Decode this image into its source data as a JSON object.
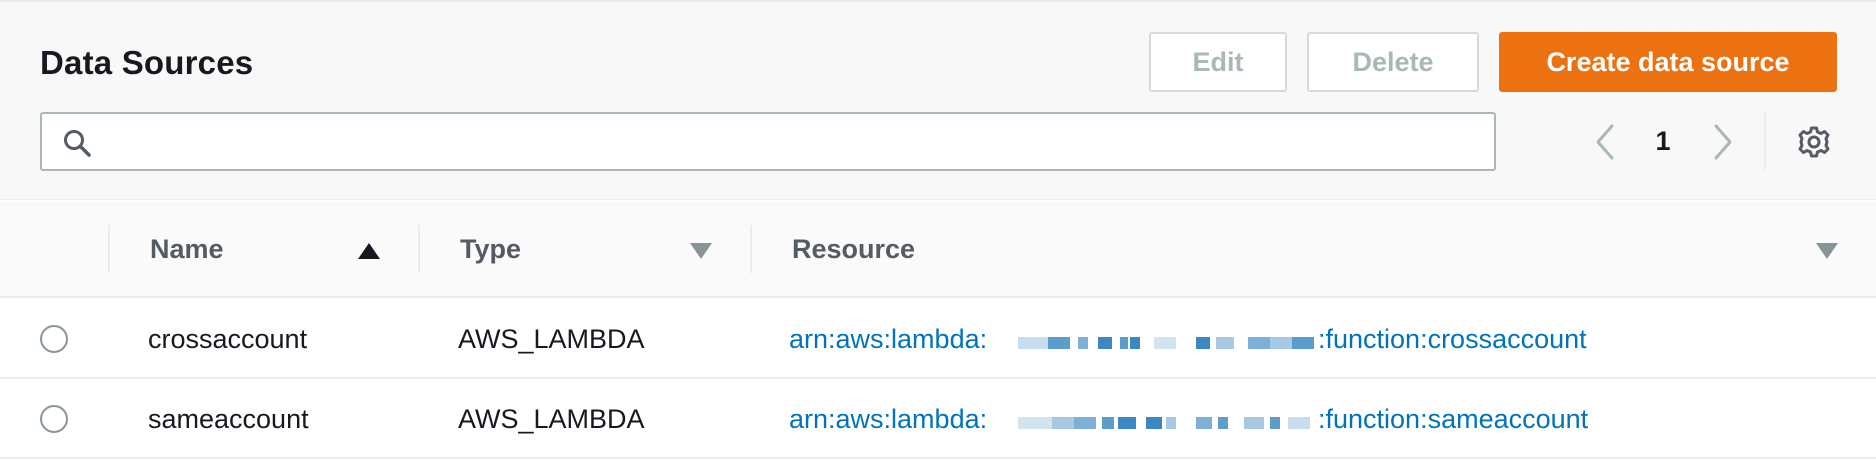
{
  "header": {
    "title": "Data Sources",
    "edit_label": "Edit",
    "delete_label": "Delete",
    "create_label": "Create data source",
    "search": {
      "value": "",
      "placeholder": ""
    },
    "page_number": "1"
  },
  "table": {
    "columns": [
      {
        "label": "Name",
        "sort": "ascending"
      },
      {
        "label": "Type",
        "sort": "none"
      },
      {
        "label": "Resource",
        "sort": "none"
      }
    ],
    "rows": [
      {
        "name": "crossaccount",
        "type": "AWS_LAMBDA",
        "resource_prefix": "arn:aws:lambda:",
        "resource_suffix": ":function:crossaccount",
        "selected": false
      },
      {
        "name": "sameaccount",
        "type": "AWS_LAMBDA",
        "resource_prefix": "arn:aws:lambda:",
        "resource_suffix": ":function:sameaccount",
        "selected": false
      }
    ]
  },
  "colors": {
    "primary": "#ec7211",
    "link": "#0073bb",
    "text": "#16191f",
    "muted": "#545b64",
    "disabled": "#aab7b8",
    "border": "#eaeded"
  },
  "icons": [
    "search-icon",
    "chevron-left-icon",
    "chevron-right-icon",
    "gear-icon",
    "sort-ascending-icon",
    "sort-descending-icon",
    "radio-icon"
  ]
}
